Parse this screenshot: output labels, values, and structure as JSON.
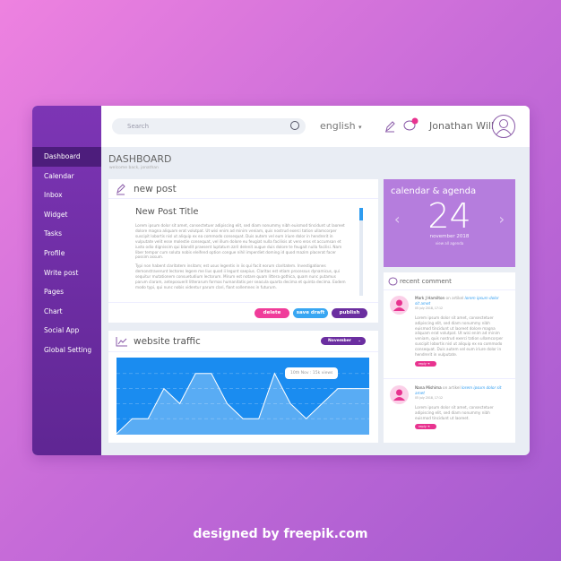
{
  "sidebar": {
    "items": [
      "Dashboard",
      "Calendar",
      "Inbox",
      "Widget",
      "Tasks",
      "Profile",
      "Write post",
      "Pages",
      "Chart",
      "Social App",
      "Global Setting"
    ],
    "active": "Dashboard",
    "color": "#6a2c9c"
  },
  "topbar": {
    "search_placeholder": "Search",
    "language": "english",
    "language_caret": "▾",
    "user_name": "Jonathan Will"
  },
  "page": {
    "title": "DASHBOARD",
    "subtitle": "welcome back, jonathan"
  },
  "new_post": {
    "header": "new post",
    "title": "New Post Title",
    "paragraphs": [
      "Lorem ipsum dolor sit amet, consectetuer adipiscing elit, sed diam nonummy nibh euismod tincidunt ut laoreet dolore magna aliquam erat volutpat. Ut wisi enim ad minim veniam, quis nostrud exerci tation ullamcorper suscipit lobortis nisl ut aliquip ex ea commodo consequat. Duis autem vel eum iriure dolor in hendrerit in vulputate velit esse molestie consequat, vel illum dolore eu feugiat nulla facilisis at vero eros et accumsan et iusto odio dignissim qui blandit praesent luptatum zzril delenit augue duis dolore te feugait nulla facilisi. Nam liber tempor cum soluta nobis eleifend option congue nihil imperdiet doming id quod mazim placerat facer possim assum.",
      "Typi non habent claritatem insitam; est usus legentis in iis qui facit eorum claritatem. Investigationes demonstraverunt lectores legere me lius quod ii legunt saepius. Claritas est etiam processus dynamicus, qui sequitur mutationem consuetudium lectorum. Mirum est notare quam littera gothica, quam nunc putamus parum claram, anteposuerit litterarum formas humanitatis per seacula quarta decima et quinta decima. Eodem modo typi, qui nunc nobis videntur parum clari, fiant sollemnes in futurum."
    ],
    "delete_label": "delete",
    "save_draft_label": "save draft",
    "publish_label": "publish",
    "colors": {
      "delete": "#f03c9a",
      "save_draft": "#38a6f2",
      "publish": "#6b2ea0"
    }
  },
  "traffic": {
    "header": "website traffic",
    "month": "November",
    "tooltip": "10th Nov : 15k views",
    "chart_data": {
      "type": "area",
      "values": [
        0,
        1,
        1,
        3,
        2,
        4,
        4,
        2,
        1,
        1,
        4,
        2,
        1,
        2,
        3,
        3
      ],
      "ylim": [
        0,
        5
      ],
      "grid": true,
      "color": "#1a8cf0"
    }
  },
  "calendar": {
    "header": "calendar & agenda",
    "day": "24",
    "month_year": "november 2018",
    "link": "view all agenda",
    "prev": "‹",
    "next": "›"
  },
  "comments": {
    "header": "recent comment",
    "items": [
      {
        "name": "Mark J Hamilton",
        "on": " on artikel ",
        "article": "lorem ipsum dolor sit amet",
        "date": "05 july 2018, 17:12",
        "text": "Lorem ipsum dolor sit amet, consectetuer adipiscing elit, sed diam nonummy nibh euismod tincidunt ut laoreet dolore magna aliquam erat volutpat. Ut wisi enim ad minim veniam, quis nostrud exerci tation ullamcorper suscipit lobortis nisl ut aliquip ex ea commodo consequat. Duis autem vel eum iriure dolor in hendrerit in vulputate.",
        "reply": "reply ➜"
      },
      {
        "name": "Nana Mishima",
        "on": " on artikel ",
        "article": "lorem ipsum dolor sit amet",
        "date": "05 july 2018, 17:12",
        "text": "Lorem ipsum dolor sit amet, consectetuer adipiscing elit, sed diam nonummy nibh euismod tincidunt ut laoreet.",
        "reply": "reply ➜"
      }
    ]
  },
  "footer": "designed by freepik.com"
}
